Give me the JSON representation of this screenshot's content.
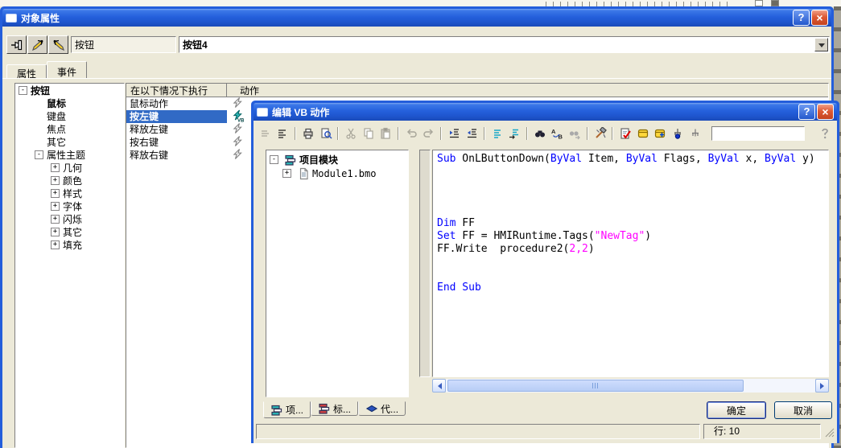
{
  "colors": {
    "titlebar_blue": "#2a64dd",
    "dialog_face": "#ece9d8",
    "selection": "#316ac5",
    "keyword": "#0000ff",
    "string_literal": "#ff00ff"
  },
  "object_properties": {
    "title": "对象属性",
    "help_label": "?",
    "close_label": "×",
    "toolbar": {
      "icons": [
        "pin-icon",
        "arrow-pen-icon",
        "arrow-pen-back-icon"
      ],
      "object_type_value": "按钮",
      "object_name_value": "按钮4"
    },
    "tabs": [
      {
        "label": "属性",
        "active": false
      },
      {
        "label": "事件",
        "active": true
      }
    ],
    "tree": [
      {
        "label": "按钮",
        "level": 0,
        "expander": "minus",
        "bold": true
      },
      {
        "label": "鼠标",
        "level": 1,
        "expander": "none",
        "bold": true
      },
      {
        "label": "键盘",
        "level": 1,
        "expander": "none",
        "bold": false
      },
      {
        "label": "焦点",
        "level": 1,
        "expander": "none",
        "bold": false
      },
      {
        "label": "其它",
        "level": 1,
        "expander": "none",
        "bold": false
      },
      {
        "label": "属性主题",
        "level": 1,
        "expander": "minus",
        "bold": false
      },
      {
        "label": "几何",
        "level": 2,
        "expander": "plus",
        "bold": false
      },
      {
        "label": "颜色",
        "level": 2,
        "expander": "plus",
        "bold": false
      },
      {
        "label": "样式",
        "level": 2,
        "expander": "plus",
        "bold": false
      },
      {
        "label": "字体",
        "level": 2,
        "expander": "plus",
        "bold": false
      },
      {
        "label": "闪烁",
        "level": 2,
        "expander": "plus",
        "bold": false
      },
      {
        "label": "其它",
        "level": 2,
        "expander": "plus",
        "bold": false
      },
      {
        "label": "填充",
        "level": 2,
        "expander": "plus",
        "bold": false
      }
    ],
    "event_table": {
      "header_condition": "在以下情况下执行",
      "header_action": "动作",
      "rows": [
        {
          "label": "鼠标动作",
          "selected": false,
          "action_icon": "script-lightning-icon"
        },
        {
          "label": "按左键",
          "selected": true,
          "action_icon": "vb-lightning-icon"
        },
        {
          "label": "释放左键",
          "selected": false,
          "action_icon": "script-lightning-icon"
        },
        {
          "label": "按右键",
          "selected": false,
          "action_icon": "script-lightning-icon"
        },
        {
          "label": "释放右键",
          "selected": false,
          "action_icon": "script-lightning-icon"
        }
      ]
    }
  },
  "vb_editor": {
    "title": "编辑 VB 动作",
    "help_label": "?",
    "close_label": "×",
    "toolbar": [
      {
        "name": "bookmark-lines-icon",
        "kind": "lines",
        "enabled": false
      },
      {
        "name": "line-numbers-icon",
        "kind": "lines2",
        "enabled": true
      },
      {
        "kind": "sep"
      },
      {
        "name": "print-icon",
        "kind": "print",
        "enabled": true
      },
      {
        "name": "print-preview-icon",
        "kind": "preview",
        "enabled": true
      },
      {
        "kind": "sep"
      },
      {
        "name": "cut-icon",
        "kind": "cut",
        "enabled": false
      },
      {
        "name": "copy-icon",
        "kind": "copy",
        "enabled": false
      },
      {
        "name": "paste-icon",
        "kind": "paste",
        "enabled": false
      },
      {
        "kind": "sep"
      },
      {
        "name": "undo-icon",
        "kind": "undo",
        "enabled": false
      },
      {
        "name": "redo-icon",
        "kind": "redo",
        "enabled": false
      },
      {
        "kind": "sep"
      },
      {
        "name": "indent-icon",
        "kind": "indent",
        "enabled": true
      },
      {
        "name": "outdent-icon",
        "kind": "outdent",
        "enabled": true
      },
      {
        "kind": "sep"
      },
      {
        "name": "comment-icon",
        "kind": "comment",
        "enabled": true
      },
      {
        "name": "uncomment-icon",
        "kind": "uncomment",
        "enabled": true
      },
      {
        "kind": "sep"
      },
      {
        "name": "find-icon",
        "kind": "find",
        "enabled": true
      },
      {
        "name": "replace-icon",
        "kind": "replace",
        "enabled": true
      },
      {
        "name": "find-next-icon",
        "kind": "findnext",
        "enabled": false
      },
      {
        "kind": "sep"
      },
      {
        "name": "tools-icon",
        "kind": "tools",
        "enabled": true
      },
      {
        "kind": "sep"
      },
      {
        "name": "syntax-check-icon",
        "kind": "check",
        "enabled": true
      },
      {
        "name": "module-icon",
        "kind": "module",
        "enabled": true
      },
      {
        "name": "add-module-icon",
        "kind": "moduleadd",
        "enabled": true
      },
      {
        "name": "toggle-breakpoint-icon",
        "kind": "breakpoint",
        "enabled": true
      },
      {
        "name": "clear-breakpoints-icon",
        "kind": "breakpoint2",
        "enabled": true
      },
      {
        "kind": "searchbox"
      },
      {
        "name": "help-drag-icon",
        "kind": "helpgray",
        "enabled": false
      }
    ],
    "project_tree": [
      {
        "label": "项目模块",
        "level": 0,
        "expander": "minus",
        "icon": "project-modules-icon",
        "bold": true,
        "mono": false
      },
      {
        "label": "Module1.bmo",
        "level": 1,
        "expander": "plus",
        "icon": "module-file-icon",
        "bold": false,
        "mono": true
      }
    ],
    "code_lines": [
      [
        {
          "t": "Sub",
          "c": "kw"
        },
        {
          "t": " OnLButtonDown(",
          "c": "pl"
        },
        {
          "t": "ByVal",
          "c": "kw"
        },
        {
          "t": " Item, ",
          "c": "pl"
        },
        {
          "t": "ByVal",
          "c": "kw"
        },
        {
          "t": " Flags, ",
          "c": "pl"
        },
        {
          "t": "ByVal",
          "c": "kw"
        },
        {
          "t": " x, ",
          "c": "pl"
        },
        {
          "t": "ByVal",
          "c": "kw"
        },
        {
          "t": " y)",
          "c": "pl"
        }
      ],
      [],
      [],
      [],
      [],
      [
        {
          "t": "Dim",
          "c": "kw"
        },
        {
          "t": " FF",
          "c": "pl"
        }
      ],
      [
        {
          "t": "Set",
          "c": "kw"
        },
        {
          "t": " FF = HMIRuntime.Tags(",
          "c": "pl"
        },
        {
          "t": "\"NewTag\"",
          "c": "str"
        },
        {
          "t": ")",
          "c": "pl"
        }
      ],
      [
        {
          "t": "FF.Write  procedure2(",
          "c": "pl"
        },
        {
          "t": "2,2",
          "c": "str"
        },
        {
          "t": ")",
          "c": "pl"
        }
      ],
      [],
      [],
      [
        {
          "t": "End Sub",
          "c": "kw"
        }
      ]
    ],
    "bottom_tabs": [
      {
        "label": "项...",
        "icon": "project-modules-tab-icon",
        "active": true
      },
      {
        "label": "标...",
        "icon": "standard-modules-tab-icon",
        "active": false
      },
      {
        "label": "代...",
        "icon": "code-templates-tab-icon",
        "active": false
      }
    ],
    "ok_label": "确定",
    "cancel_label": "取消",
    "status_line": "行: 10"
  }
}
